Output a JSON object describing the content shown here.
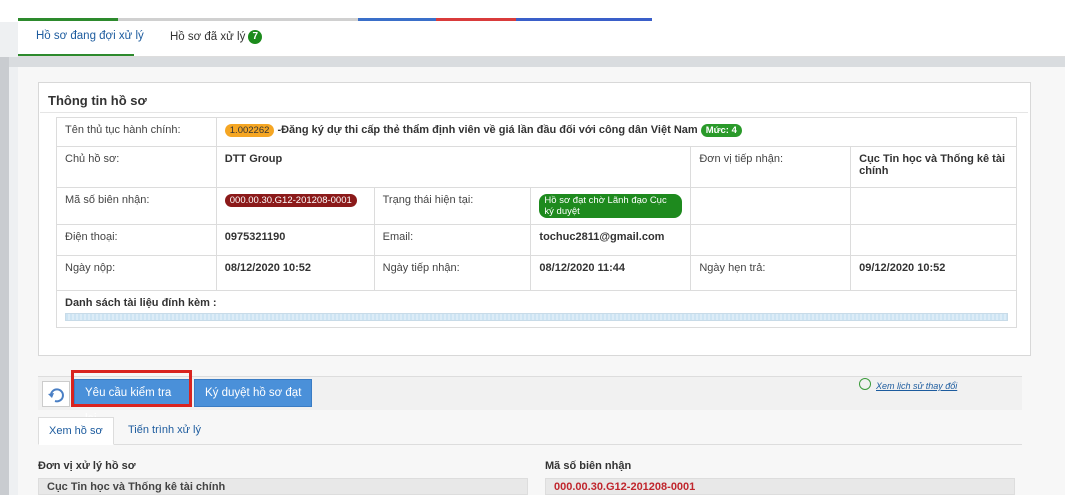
{
  "top_tabs": [
    {
      "label": "Hồ sơ đang đợi xử lý",
      "active": true
    },
    {
      "label": "Hồ sơ đã xử lý",
      "active": false,
      "badge": "7"
    }
  ],
  "info_section": {
    "title": "Thông tin hồ sơ",
    "procedure": {
      "label": "Tên thủ tục hành chính:",
      "code": "1.002262",
      "name": "-Đăng ký dự thi cấp thẻ thẩm định viên về giá lần đầu đối với công dân Việt Nam",
      "level": "Mức: 4"
    },
    "owner": {
      "label": "Chủ hồ sơ:",
      "value": "DTT Group"
    },
    "receiving_unit": {
      "label": "Đơn vị tiếp nhận:",
      "value": "Cục Tin học và Thống kê tài chính"
    },
    "receipt_no": {
      "label": "Mã số biên nhận:",
      "value": "000.00.30.G12-201208-0001"
    },
    "status": {
      "label": "Trạng thái hiện tại:",
      "value": "Hồ sơ đạt chờ Lãnh đạo Cục ký duyệt"
    },
    "phone": {
      "label": "Điện thoại:",
      "value": "0975321190"
    },
    "email": {
      "label": "Email:",
      "value": "tochuc2811@gmail.com"
    },
    "submitted": {
      "label": "Ngày nộp:",
      "value": "08/12/2020 10:52"
    },
    "received": {
      "label": "Ngày tiếp nhận:",
      "value": "08/12/2020 11:44"
    },
    "due": {
      "label": "Ngày hẹn trả:",
      "value": "09/12/2020 10:52"
    },
    "attachments_label": "Danh sách tài liệu đính kèm :"
  },
  "toolbar": {
    "request_recheck": "Yêu cầu kiểm tra lại",
    "approve": "Ký duyệt hồ sơ đạt",
    "history_link": "Xem lịch sử thay đổi"
  },
  "lower_tabs": [
    {
      "label": "Xem hồ sơ",
      "active": true
    },
    {
      "label": "Tiến trình xử lý",
      "active": false
    }
  ],
  "fields": {
    "unit_label": "Đơn vị xử lý hồ sơ",
    "unit_value": "Cục Tin học và Thống kê tài chính",
    "receipt_label": "Mã số biên nhận",
    "receipt_value": "000.00.30.G12-201208-0001"
  },
  "colors": {
    "link": "#1c5b9e",
    "button": "#4a90d9",
    "highlight": "#d9231f",
    "receipt_red": "#c0262d"
  }
}
